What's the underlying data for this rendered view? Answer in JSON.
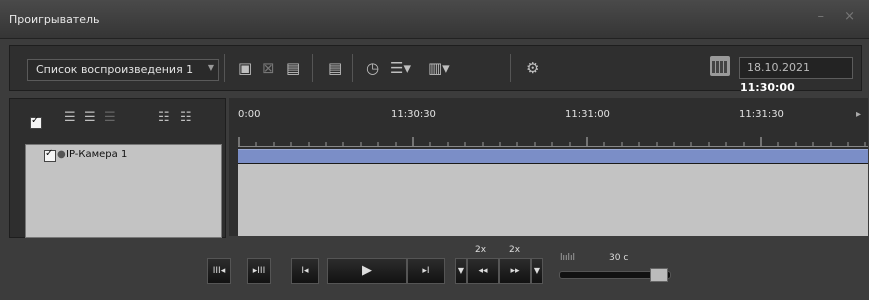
{
  "window": {
    "title": "Проигрыватель",
    "controls": "– ×"
  },
  "toolbar": {
    "playlist_value": "Список воспроизведения 1",
    "date": "18.10.2021",
    "time": "11:30:00"
  },
  "timeline": {
    "ticks": [
      "0:00",
      "11:30:30",
      "11:31:00",
      "11:31:30"
    ]
  },
  "cameras": [
    {
      "name": "IP-Камера 1",
      "checked": true
    }
  ],
  "playback": {
    "speed_left": "2x",
    "speed_right": "2x",
    "interval": "30 с"
  }
}
